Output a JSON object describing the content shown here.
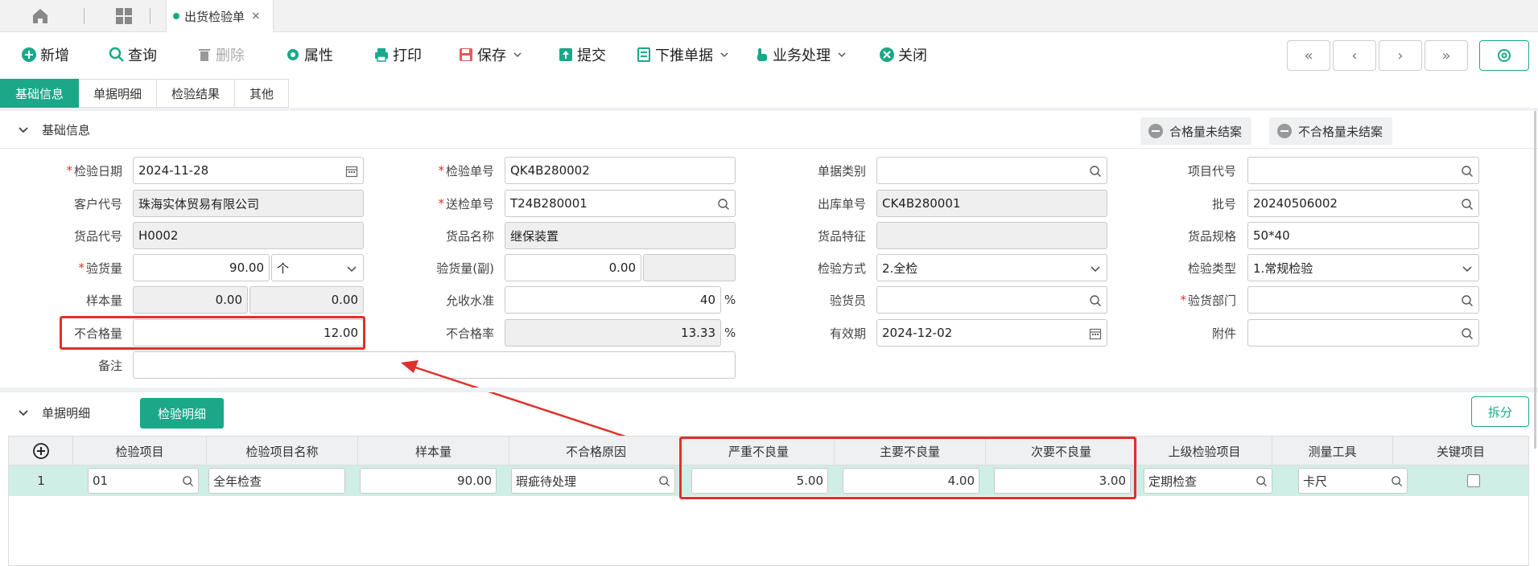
{
  "tabbar": {
    "doc_tab": "出货检验单",
    "close": "×"
  },
  "toolbar": {
    "new": "新增",
    "query": "查询",
    "delete": "删除",
    "attr": "属性",
    "print": "打印",
    "save": "保存",
    "submit": "提交",
    "push": "下推单据",
    "biz": "业务处理",
    "close": "关闭"
  },
  "nav": {
    "first": "«",
    "prev": "‹",
    "next": "›",
    "last": "»"
  },
  "tabs": [
    "基础信息",
    "单据明细",
    "检验结果",
    "其他"
  ],
  "basic": {
    "title": "基础信息",
    "pill_ok": "合格量未结案",
    "pill_ng": "不合格量未结案",
    "labels": {
      "inspect_date": "检验日期",
      "inspect_no": "检验单号",
      "doc_type": "单据类别",
      "project_code": "项目代号",
      "customer": "客户代号",
      "send_no": "送检单号",
      "out_no": "出库单号",
      "batch": "批号",
      "goods_code": "货品代号",
      "goods_name": "货品名称",
      "goods_feature": "货品特征",
      "goods_spec": "货品规格",
      "qty": "验货量",
      "qty2": "验货量(副)",
      "method": "检验方式",
      "inspect_type": "检验类型",
      "sample": "样本量",
      "accept": "允收水准",
      "inspector": "验货员",
      "dept": "验货部门",
      "ng_qty": "不合格量",
      "ng_rate": "不合格率",
      "expiry": "有效期",
      "attach": "附件",
      "remark": "备注"
    },
    "values": {
      "inspect_date": "2024-11-28",
      "inspect_no": "QK4B280002",
      "doc_type": "",
      "project_code": "",
      "customer": "珠海实体贸易有限公司",
      "send_no": "T24B280001",
      "out_no": "CK4B280001",
      "batch": "20240506002",
      "goods_code": "H0002",
      "goods_name": "继保装置",
      "goods_feature": "",
      "goods_spec": "50*40",
      "qty": "90.00",
      "unit": "个",
      "qty2": "0.00",
      "qty2_unit": "",
      "method": "2.全检",
      "inspect_type": "1.常规检验",
      "sample": "0.00",
      "sample2": "0.00",
      "accept": "40",
      "inspector": "",
      "dept": "",
      "ng_qty": "12.00",
      "ng_rate": "13.33",
      "expiry": "2024-12-02",
      "attach": "",
      "remark": ""
    },
    "pct": "%"
  },
  "detail": {
    "title": "单据明细",
    "tab": "检验明细",
    "split": "拆分",
    "add": "+",
    "columns": [
      "检验项目",
      "检验项目名称",
      "样本量",
      "不合格原因",
      "严重不良量",
      "主要不良量",
      "次要不良量",
      "上级检验项目",
      "测量工具",
      "关键项目"
    ],
    "rows": [
      {
        "no": "1",
        "item": "01",
        "name": "全年检查",
        "sample": "90.00",
        "reason": "瑕疵待处理",
        "critical": "5.00",
        "major": "4.00",
        "minor": "3.00",
        "parent": "定期检查",
        "tool": "卡尺",
        "key": false
      }
    ]
  }
}
